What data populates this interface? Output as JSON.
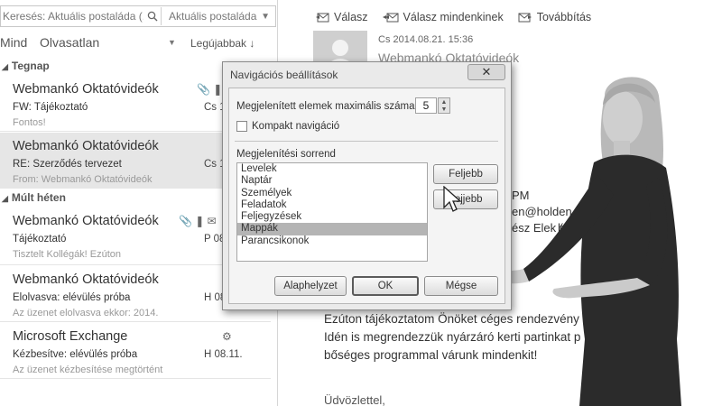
{
  "search": {
    "query": "Keresés: Aktuális postaláda (...",
    "scope": "Aktuális postaláda"
  },
  "filters": {
    "all": "Mind",
    "unread": "Olvasatlan",
    "sort": "Legújabbak"
  },
  "groups": [
    "Tegnap",
    "Múlt héten"
  ],
  "messages": [
    {
      "from": "Webmankó Oktatóvideók",
      "subject": "FW: Tájékoztató",
      "preview": "Fontos!",
      "date": "Cs 1",
      "icons": "📎 ❚"
    },
    {
      "from": "Webmankó Oktatóvideók",
      "subject": "RE: Szerződés tervezet",
      "preview": "From: Webmankó Oktatóvideók",
      "date": "Cs 1",
      "icons": ""
    },
    {
      "from": "Webmankó Oktatóvideók",
      "subject": "Tájékoztató",
      "preview": "Tisztelt Kollégák!  Ezúton",
      "date": "P 08",
      "icons": "📎 ❚ ✉"
    },
    {
      "from": "Webmankó Oktatóvideók",
      "subject": "Elolvasva: elévülés próba",
      "preview": "Az üzenet elolvasva ekkor: 2014.",
      "date": "H 08",
      "icons": ""
    },
    {
      "from": "Microsoft Exchange",
      "subject": "Kézbesítve: elévülés próba",
      "preview": "Az üzenet kézbesítése megtörtént",
      "date": "H 08.11.",
      "icons": "⚙"
    }
  ],
  "reading": {
    "actions": [
      "Válasz",
      "Válasz mindenkinek",
      "Továbbítás"
    ],
    "date": "Cs 2014.08.21. 15:36",
    "sender": "Webmankó Oktatóvideók",
    "fragments": [
      "PM",
      "en@holden.hu'",
      "ész Elek (",
      "holden"
    ],
    "body": [
      "Ezúton tájékoztatom Önöket céges rendezvény",
      "Idén is megrendezzük nyárzáró kerti partinkat p",
      "bőséges programmal várunk mindenkit!"
    ],
    "greeting": "Üdvözlettel,"
  },
  "dialog": {
    "title": "Navigációs beállítások",
    "close": "✕",
    "max_label": "Megjelenített elemek maximális száma:",
    "max_value": "5",
    "compact_label": "Kompakt navigáció",
    "compact_checked": false,
    "order_label": "Megjelenítési sorrend",
    "order_items": [
      "Levelek",
      "Naptár",
      "Személyek",
      "Feladatok",
      "Feljegyzések",
      "Mappák",
      "Parancsikonok"
    ],
    "selected_index": 5,
    "up": "Feljebb",
    "down": "Lejjebb",
    "reset": "Alaphelyzet",
    "ok": "OK",
    "cancel": "Mégse"
  }
}
